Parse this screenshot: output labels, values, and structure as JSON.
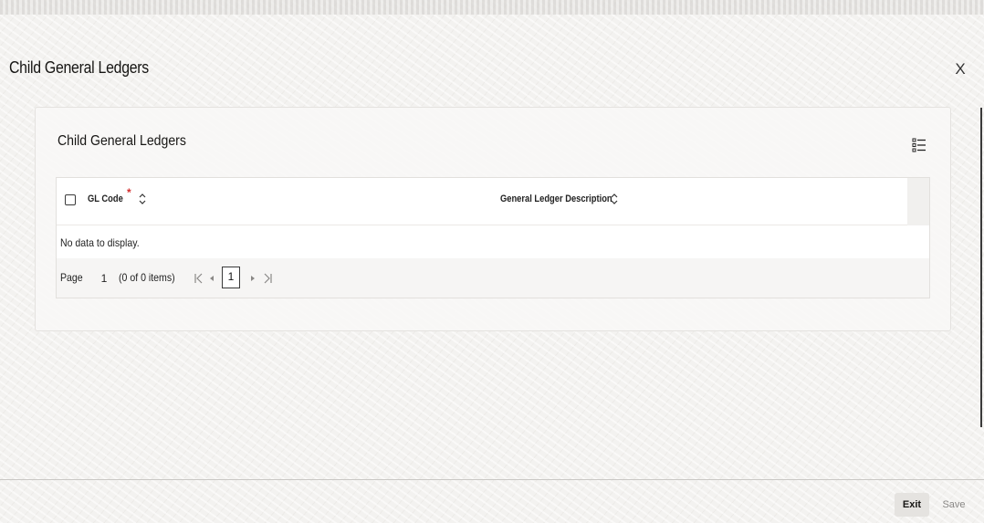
{
  "dialog": {
    "title": "Child General Ledgers",
    "close_label": "X"
  },
  "panel": {
    "title": "Child General Ledgers",
    "settings_icon": "list-settings-icon"
  },
  "grid": {
    "columns": [
      {
        "label": "GL Code",
        "required": true,
        "sortable": true
      },
      {
        "label": "General Ledger Description",
        "required": false,
        "sortable": true
      }
    ],
    "required_marker": "*",
    "empty_message": "No data to display.",
    "pagination": {
      "page_label": "Page",
      "page_value": "1",
      "items_summary": "(0 of 0 items)",
      "current_page": "1"
    }
  },
  "footer": {
    "exit_label": "Exit",
    "save_label": "Save"
  },
  "colors": {
    "required": "#d32f2f",
    "text": "#161513",
    "disabled_text": "#8a8886"
  }
}
